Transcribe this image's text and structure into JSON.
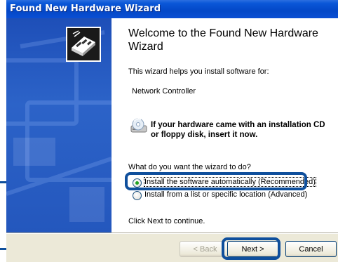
{
  "window": {
    "title": "Found New Hardware Wizard"
  },
  "main": {
    "heading": "Welcome to the Found New Hardware Wizard",
    "intro": "This wizard helps you install software for:",
    "device": "Network Controller",
    "cd_prompt": "If your hardware came with an installation CD or floppy disk, insert it now.",
    "question": "What do you want the wizard to do?",
    "options": [
      {
        "label": "Install the software automatically (Recommended)",
        "selected": true
      },
      {
        "label": "Install from a list or specific location (Advanced)",
        "selected": false
      }
    ],
    "continue_text": "Click Next to continue."
  },
  "buttons": {
    "back": "< Back",
    "next": "Next >",
    "cancel": "Cancel"
  },
  "colors": {
    "highlight": "#0f4f9c",
    "sidebar": "#2457bd",
    "titlebar": "#0347c7"
  },
  "icons": [
    "hardware-wizard-icon",
    "cd-drive-icon"
  ]
}
